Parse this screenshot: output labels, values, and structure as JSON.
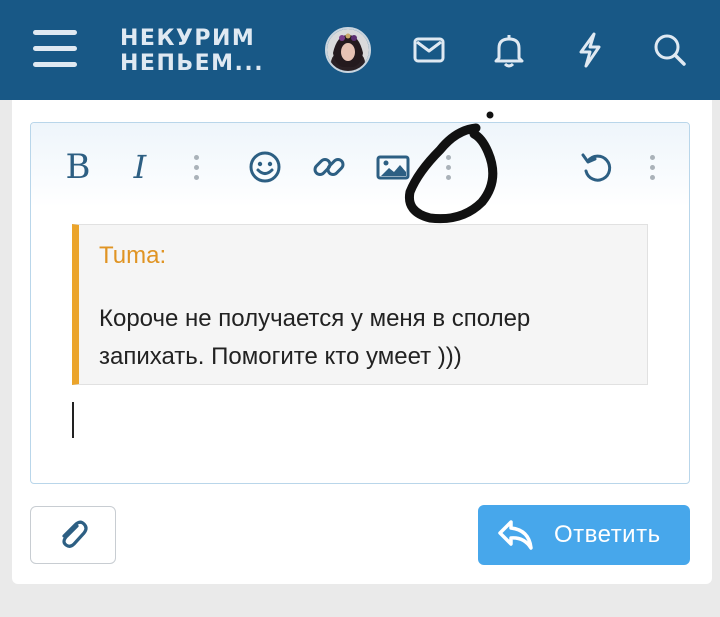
{
  "header": {
    "logo_line1": "НЕКУРИМ",
    "logo_line2": "НЕПЬЕМ...",
    "icons": [
      "menu-icon",
      "avatar",
      "envelope-icon",
      "bell-icon",
      "lightning-icon",
      "search-icon"
    ]
  },
  "toolbar": {
    "bold_label": "B",
    "italic_label": "I",
    "icons": [
      "more-options-icon",
      "emoji-icon",
      "link-icon",
      "image-icon",
      "more-options-icon",
      "undo-icon",
      "more-options-icon"
    ]
  },
  "quote": {
    "author": "Tuma:",
    "text": "Короче не получается у меня в сполер запихать. Помогите кто умеет )))"
  },
  "actions": {
    "attach_icon": "paperclip-icon",
    "reply_icon": "reply-arrow-icon",
    "reply_label": "Ответить"
  },
  "colors": {
    "header_bg": "#185886",
    "header_icons": "#dfe9f2",
    "toolbar_icons": "#2d5f83",
    "quote_accent": "#eba42b",
    "reply_button": "#47a7eb",
    "annotation": "#111111"
  }
}
